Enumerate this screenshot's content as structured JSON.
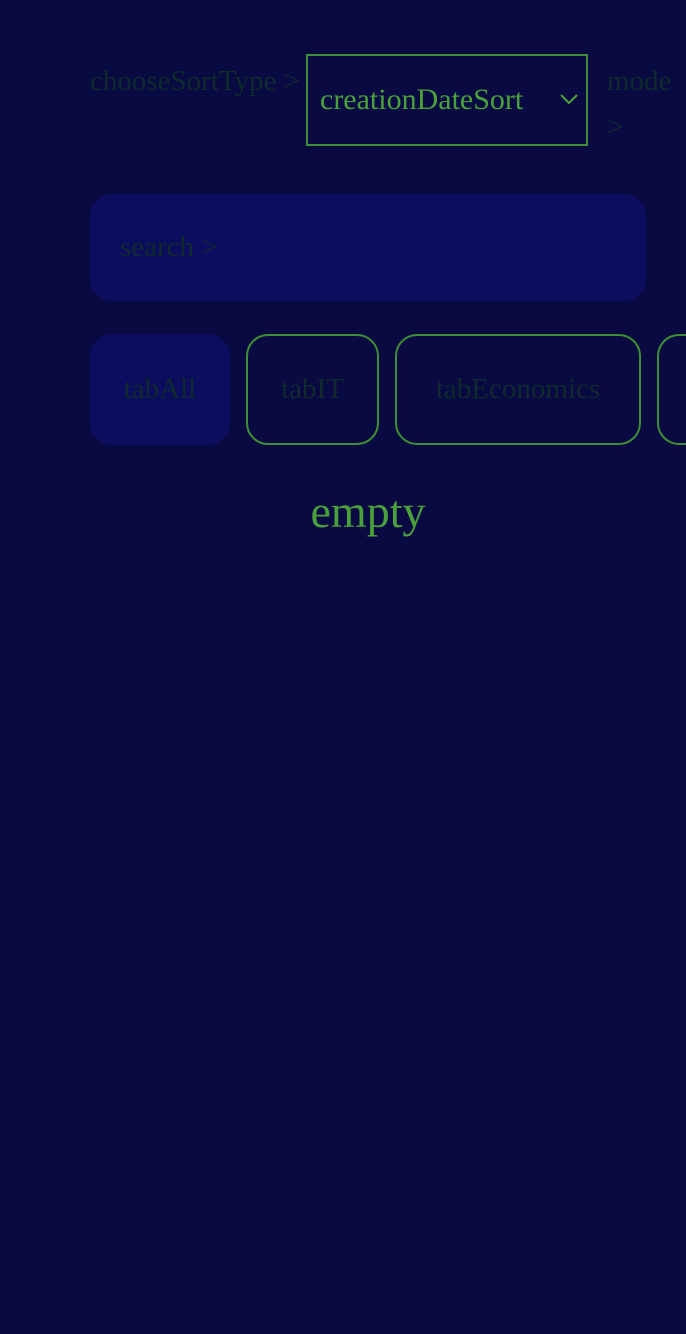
{
  "colors": {
    "background": "#090a42",
    "surface": "#0c0d5e",
    "accent": "#4aa03a",
    "border": "#3e8f33",
    "muted_text": "#0e2a2c"
  },
  "sort": {
    "label": "chooseSortType >",
    "selected": "creationDateSort",
    "chevron_icon": "chevron-down-icon"
  },
  "mode": {
    "label": "mode >"
  },
  "search": {
    "placeholder": "search >"
  },
  "tabs": [
    {
      "label": "tabAll",
      "active": true
    },
    {
      "label": "tabIT",
      "active": false
    },
    {
      "label": "tabEconomics",
      "active": false
    },
    {
      "label": "",
      "active": false
    }
  ],
  "empty_state": {
    "text": "empty"
  }
}
